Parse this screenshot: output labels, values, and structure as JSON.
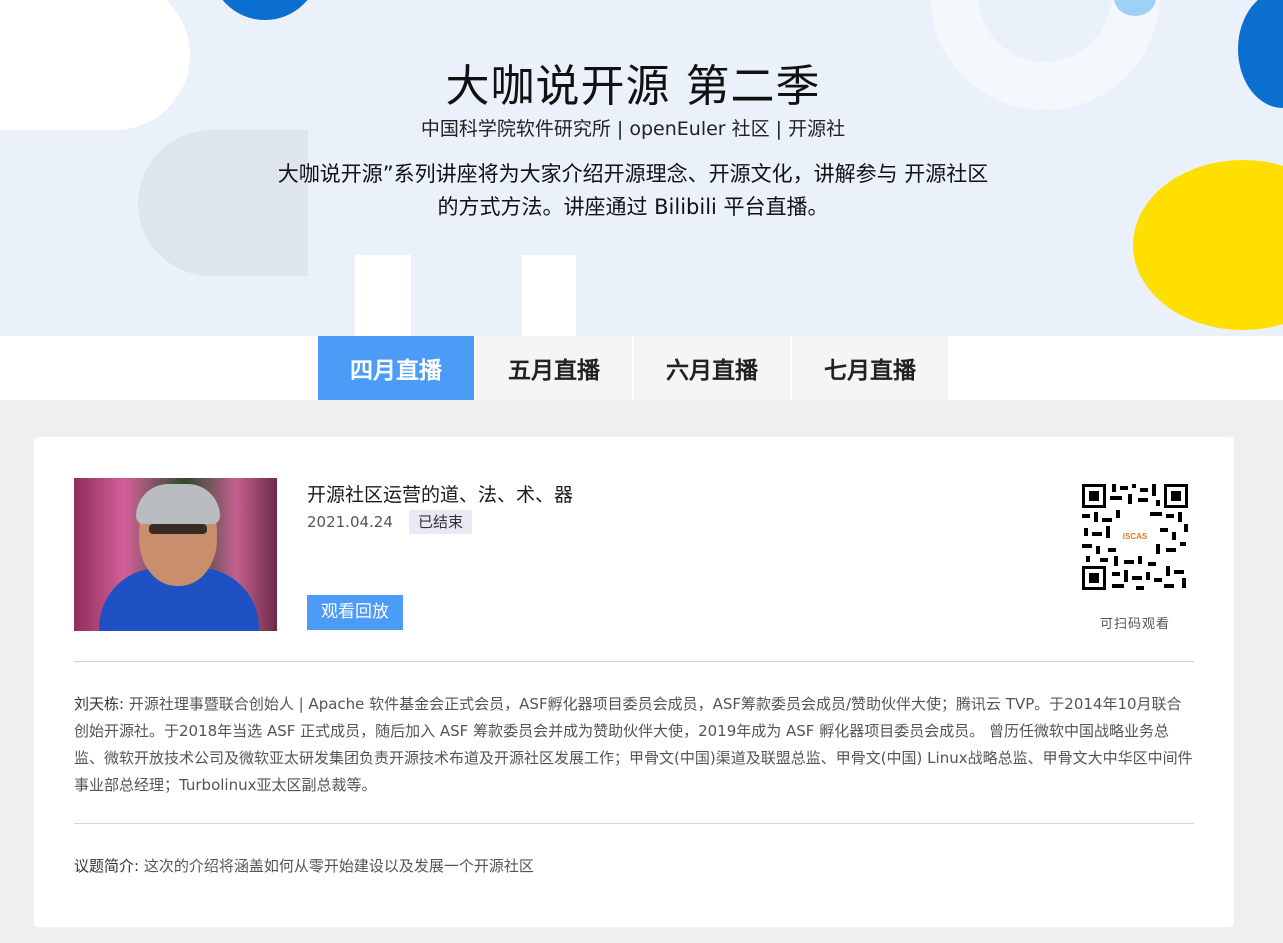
{
  "hero": {
    "title": "大咖说开源 第二季",
    "subtitle": "中国科学院软件研究所 | openEuler 社区 | 开源社",
    "description_line1": "大咖说开源”系列讲座将为大家介绍开源理念、开源文化，讲解参与 开源社区",
    "description_line2": "的方式方法。讲座通过 Bilibili 平台直播。"
  },
  "tabs": [
    {
      "label": "四月直播",
      "active": true
    },
    {
      "label": "五月直播",
      "active": false
    },
    {
      "label": "六月直播",
      "active": false
    },
    {
      "label": "七月直播",
      "active": false
    }
  ],
  "talk": {
    "title": "开源社区运营的道、法、术、器",
    "date": "2021.04.24",
    "status": "已结束",
    "replay_button": "观看回放",
    "qr_caption": "可扫码观看",
    "speaker_name": "刘天栋:",
    "speaker_bio": "开源社理事暨联合创始人 | Apache 软件基金会正式会员，ASF孵化器项目委员会成员，ASF筹款委员会成员/赞助伙伴大使；腾讯云 TVP。于2014年10月联合创始开源社。于2018年当选 ASF 正式成员，随后加入 ASF 筹款委员会并成为赞助伙伴大使，2019年成为 ASF 孵化器项目委员会成员。 曾历任微软中国战略业务总监、微软开放技术公司及微软亚太研发集团负责开源技术布道及开源社区发展工作；甲骨文(中国)渠道及联盟总监、甲骨文(中国) Linux战略总监、甲骨文大中华区中间件事业部总经理；Turbolinux亚太区副总裁等。",
    "topic_label": "议题简介:",
    "topic_text": "这次的介绍将涵盖如何从零开始建设以及发展一个开源社区"
  },
  "colors": {
    "accent_blue": "#4c9bf7",
    "brand_blue": "#0b6fd0",
    "yellow": "#ffdf00"
  }
}
